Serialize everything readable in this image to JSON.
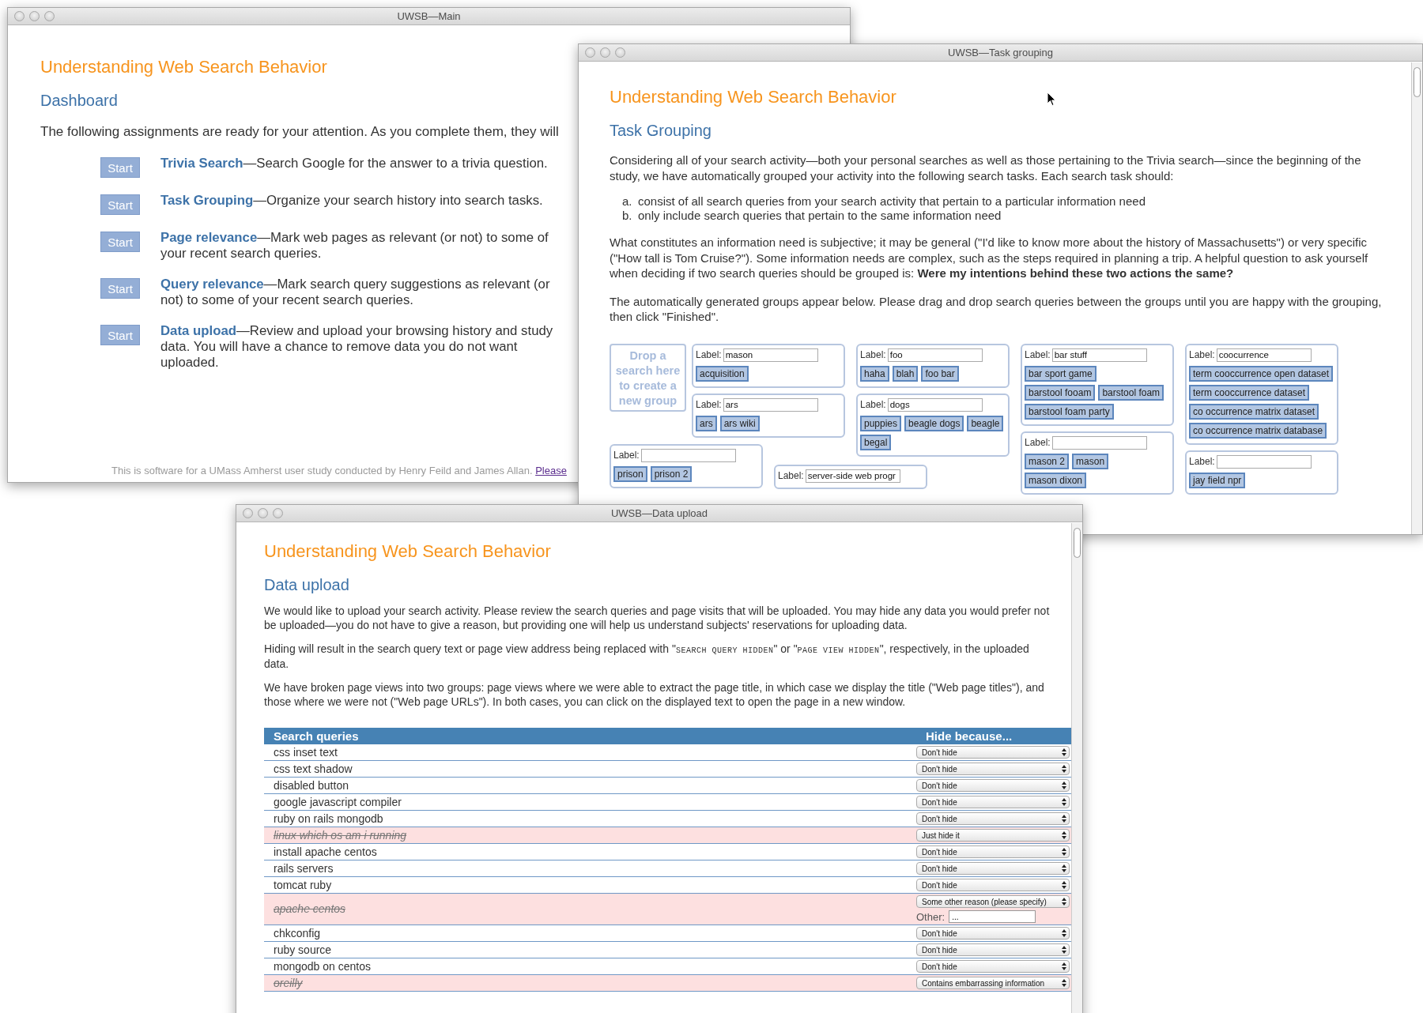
{
  "main_window": {
    "title": "UWSB—Main",
    "heading": "Understanding Web Search Behavior",
    "subheading": "Dashboard",
    "intro": "The following assignments are ready for your attention. As you complete them, they will",
    "assignments": [
      {
        "button": "Start",
        "link": "Trivia Search",
        "description": "—Search Google for the answer to a trivia question."
      },
      {
        "button": "Start",
        "link": "Task Grouping",
        "description": "—Organize your search history into search tasks."
      },
      {
        "button": "Start",
        "link": "Page relevance",
        "description": "—Mark web pages as relevant (or not) to some of your recent search queries."
      },
      {
        "button": "Start",
        "link": "Query relevance",
        "description": "—Mark search query suggestions as relevant (or not) to some of your recent search queries."
      },
      {
        "button": "Start",
        "link": "Data upload",
        "description": "—Review and upload your browsing history and study data. You will have a chance to remove data you do not want uploaded."
      }
    ],
    "footer": {
      "text": "This is software for a UMass Amherst user study conducted by Henry Feild and James Allan.",
      "link": "Please"
    }
  },
  "task_window": {
    "title": "UWSB—Task grouping",
    "heading": "Understanding Web Search Behavior",
    "subheading": "Task Grouping",
    "intro": "Considering all of your search activity—both your personal searches as well as those pertaining to the Trivia search—since the beginning of the study, we have automatically grouped your activity into the following search tasks. Each search task should:",
    "criteria": [
      {
        "marker": "a.",
        "text": "consist of all search queries from your search activity that pertain to a particular information need"
      },
      {
        "marker": "b.",
        "text": "only include search queries that pertain to the same information need"
      }
    ],
    "note": "What constitutes an information need is subjective; it may be general (\"I'd like to know more about the history of Massachusetts\") or very specific (\"How tall is Tom Cruise?\"). Some information needs are complex, such as the steps required in planning a trip. A helpful question to ask yourself when deciding if two search queries should be grouped is: **Were my intentions behind these two actions the same?**",
    "instructions": "The automatically generated groups appear below. Please drag and drop search queries between the groups until you are happy with the grouping, then click \"Finished\".",
    "drop_zone": "Drop a search here to create a new group",
    "group_columns": [
      [
        {
          "caption": "Label:",
          "label": "mason",
          "queries": [
            "acquisition"
          ]
        },
        {
          "caption": "Label:",
          "label": "ars",
          "queries": [
            "ars",
            "ars wiki"
          ]
        }
      ],
      [
        {
          "caption": "Label:",
          "label": "foo",
          "queries": [
            "haha",
            "blah",
            "foo bar"
          ]
        },
        {
          "caption": "Label:",
          "label": "dogs",
          "queries": [
            "puppies",
            "beagle dogs",
            "beagle",
            "begal"
          ]
        }
      ],
      [
        {
          "caption": "Label:",
          "label": "bar stuff",
          "queries": [
            "bar sport game",
            "barstool fooam",
            "barstool foam",
            "barstool foam party"
          ]
        },
        {
          "caption": "Label:",
          "queries": [
            "mason 2",
            "mason",
            "mason dixon"
          ]
        }
      ],
      [
        {
          "caption": "Label:",
          "label": "coocurrence",
          "queries": [
            "term cooccurrence open dataset",
            "term cooccurrence dataset",
            "co occurrence matrix dataset",
            "co occurrence matrix database"
          ]
        },
        {
          "caption": "Label:",
          "queries": [
            "jay field npr"
          ]
        }
      ]
    ],
    "lower_groups": [
      {
        "caption": "Label:",
        "queries": [
          "prison",
          "prison 2"
        ]
      },
      {
        "caption": "Label:",
        "label": "server-side web progr"
      }
    ]
  },
  "upload_window": {
    "title": "UWSB—Data upload",
    "heading": "Understanding Web Search Behavior",
    "subheading": "Data upload",
    "paragraphs": [
      [
        {
          "kind": "text",
          "text": "We would like to upload your search activity. Please review the search queries and page visits that will be uploaded. You may hide any data you would prefer not be uploaded—you do not have to give a reason, but providing one will help us understand subjects' reservations for uploading data."
        }
      ],
      [
        {
          "kind": "text",
          "text": "Hiding will result in the search query text or page view address being replaced with \""
        },
        {
          "kind": "code",
          "text": "SEARCH QUERY HIDDEN"
        },
        {
          "kind": "text",
          "text": "\" or \""
        },
        {
          "kind": "code",
          "text": "PAGE VIEW HIDDEN"
        },
        {
          "kind": "text",
          "text": "\", respectively, in the uploaded data."
        }
      ],
      [
        {
          "kind": "text",
          "text": "We have broken page views into two groups: page views where we were able to extract the page title, in which case we display the title (\"Web page titles\"), and those where we were not (\"Web page URLs\"). In both cases, you can click on the displayed text to open the page in a new window."
        }
      ]
    ],
    "table": {
      "columns": [
        "Search queries",
        "Hide because..."
      ],
      "rows": [
        {
          "query": "css inset text",
          "hidden": false,
          "reason": "Don't hide"
        },
        {
          "query": "css text shadow",
          "hidden": false,
          "reason": "Don't hide"
        },
        {
          "query": "disabled button",
          "hidden": false,
          "reason": "Don't hide"
        },
        {
          "query": "google javascript compiler",
          "hidden": false,
          "reason": "Don't hide"
        },
        {
          "query": "ruby on rails mongodb",
          "hidden": false,
          "reason": "Don't hide"
        },
        {
          "query": "linux which os am i running",
          "hidden": true,
          "reason": "Just hide it"
        },
        {
          "query": "install apache centos",
          "hidden": false,
          "reason": "Don't hide"
        },
        {
          "query": "rails servers",
          "hidden": false,
          "reason": "Don't hide"
        },
        {
          "query": "tomcat ruby",
          "hidden": false,
          "reason": "Don't hide"
        },
        {
          "query": "apache centos",
          "hidden": true,
          "reason": "Some other reason (please specify)",
          "other_label": "Other:",
          "other_value": "..."
        },
        {
          "query": "chkconfig",
          "hidden": false,
          "reason": "Don't hide"
        },
        {
          "query": "ruby source",
          "hidden": false,
          "reason": "Don't hide"
        },
        {
          "query": "mongodb on centos",
          "hidden": false,
          "reason": "Don't hide"
        },
        {
          "query": "oreilly",
          "hidden": true,
          "reason": "Contains embarrassing information"
        }
      ]
    }
  }
}
